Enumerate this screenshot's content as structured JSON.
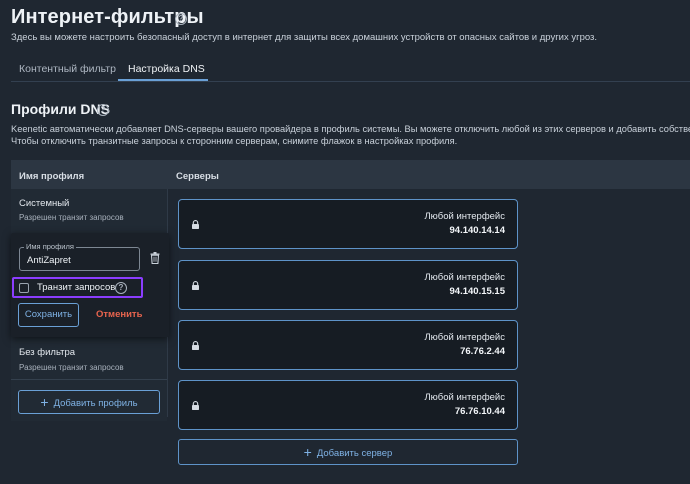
{
  "header": {
    "title": "Интернет-фильтры",
    "subtitle": "Здесь вы можете настроить безопасный доступ в интернет для защиты всех домашних устройств от опасных сайтов и других угроз."
  },
  "tabs": [
    {
      "label": "Контентный фильтр",
      "active": false
    },
    {
      "label": "Настройка DNS",
      "active": true
    }
  ],
  "section": {
    "title": "Профили DNS",
    "desc_line1": "Keenetic автоматически добавляет DNS-серверы вашего провайдера в профиль системы. Вы можете отключить любой из этих серверов и добавить собственные.",
    "desc_line2": "Чтобы отключить транзитные запросы к сторонним серверам, снимите флажок в настройках профиля."
  },
  "table": {
    "col_name": "Имя профиля",
    "col_servers": "Серверы"
  },
  "profiles": [
    {
      "name": "Системный",
      "sub": "Разрешен транзит запросов"
    },
    {
      "name": "Без фильтра",
      "sub": "Разрешен транзит запросов"
    }
  ],
  "editor": {
    "field_label": "Имя профиля",
    "field_value": "AntiZapret",
    "checkbox_label": "Транзит запросов",
    "checkbox_checked": false,
    "save_label": "Сохранить",
    "cancel_label": "Отменить"
  },
  "add_profile_label": "Добавить профиль",
  "servers": [
    {
      "interface": "Любой интерфейс",
      "ip": "94.140.14.14"
    },
    {
      "interface": "Любой интерфейс",
      "ip": "94.140.15.15"
    },
    {
      "interface": "Любой интерфейс",
      "ip": "76.76.2.44"
    },
    {
      "interface": "Любой интерфейс",
      "ip": "76.76.10.44"
    }
  ],
  "add_server_label": "Добавить сервер",
  "colors": {
    "background": "#1f2731",
    "accent": "#6aa0d6",
    "danger": "#e8644e",
    "highlight": "#8b3dff"
  },
  "icons": {
    "help": "help-circle-icon",
    "lock": "lock-icon",
    "trash": "trash-icon",
    "plus": "plus-icon"
  }
}
